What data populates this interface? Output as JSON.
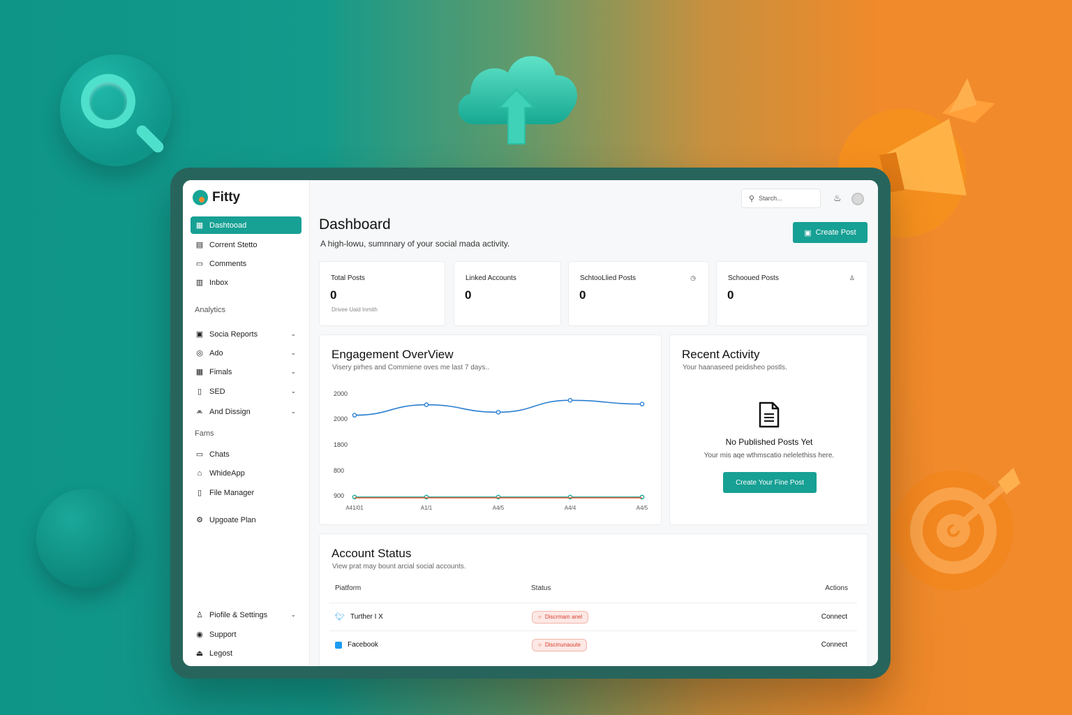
{
  "app": {
    "name": "Fitty"
  },
  "sidebar": {
    "items": [
      {
        "label": "Dashtooad",
        "icon": "dashboard-icon",
        "active": true
      },
      {
        "label": "Corrent Stetto",
        "icon": "content-icon"
      },
      {
        "label": "Comments",
        "icon": "comment-icon"
      },
      {
        "label": "Inbox",
        "icon": "inbox-icon"
      }
    ],
    "analytics_label": "Analytics",
    "analytics_items": [
      {
        "label": "Socia Reports",
        "icon": "report-icon"
      },
      {
        "label": "Ado",
        "icon": "ads-icon"
      },
      {
        "label": "Fimals",
        "icon": "table-icon"
      },
      {
        "label": "SED",
        "icon": "seo-icon"
      },
      {
        "label": "And Dissign",
        "icon": "design-icon"
      }
    ],
    "fams_label": "Fams",
    "fams_items": [
      {
        "label": "Chats",
        "icon": "chat-icon"
      },
      {
        "label": "WhideApp",
        "icon": "app-icon"
      },
      {
        "label": "File Manager",
        "icon": "file-icon"
      }
    ],
    "upgrade_label": "Upgoate Plan",
    "bottom_items": [
      {
        "label": "Piofile & Settings",
        "icon": "user-icon"
      },
      {
        "label": "Support",
        "icon": "support-icon"
      },
      {
        "label": "Legost",
        "icon": "logout-icon"
      }
    ]
  },
  "header": {
    "search_placeholder": "Starch...",
    "title": "Dashboard",
    "subtitle": "A high-lowu, sumnnary of your social mada activity.",
    "create_label": "Create Post"
  },
  "stats": [
    {
      "label": "Total Posts",
      "value": "0",
      "note": "Drivee Uaid Inmith"
    },
    {
      "label": "Linked Accounts",
      "value": "0"
    },
    {
      "label": "SchtooLlied Posts",
      "value": "0"
    },
    {
      "label": "Schooued Posts",
      "value": "0"
    }
  ],
  "engagement": {
    "title": "Engagement OverView",
    "subtitle": "Visery pirhes and Commiene oves me last 7 days.."
  },
  "chart_data": {
    "type": "line",
    "title": "Engagement OverView",
    "y_tick_labels": [
      "2000",
      "2000",
      "1800",
      "800",
      "900"
    ],
    "x_tick_labels": [
      "A41/01",
      "A1/1",
      "A4/5",
      "A4/4",
      "A4/5"
    ],
    "series": [
      {
        "color": "#2a7fd1",
        "values": [
          2000,
          2140,
          2040,
          2200,
          2150
        ]
      },
      {
        "color": "#1aa896",
        "values": [
          900,
          900,
          900,
          900,
          900
        ]
      },
      {
        "color": "#e0603e",
        "values": [
          890,
          890,
          890,
          890,
          890
        ]
      }
    ]
  },
  "recent": {
    "title": "Recent Activity",
    "subtitle": "Your haanaseed peidisheo postls.",
    "empty_title": "No Published Posts Yet",
    "empty_sub": "Your mis aqe wthmscatio nelelethiss here.",
    "button": "Create Your Fine Post"
  },
  "account_status": {
    "title": "Account Status",
    "subtitle": "View prat may bount arcial social accounts.",
    "headers": {
      "platform": "Piatform",
      "status": "Status",
      "actions": "Actions"
    },
    "rows": [
      {
        "platform": "Turther I X",
        "status": "Discrmam anel",
        "action": "Connect",
        "icon": "twitter-icon"
      },
      {
        "platform": "Facebook",
        "status": "Discmunauute",
        "action": "Connect",
        "icon": "facebook-icon"
      }
    ]
  },
  "colors": {
    "accent": "#17a094",
    "orange": "#f28a2c",
    "danger": "#d6412f"
  }
}
